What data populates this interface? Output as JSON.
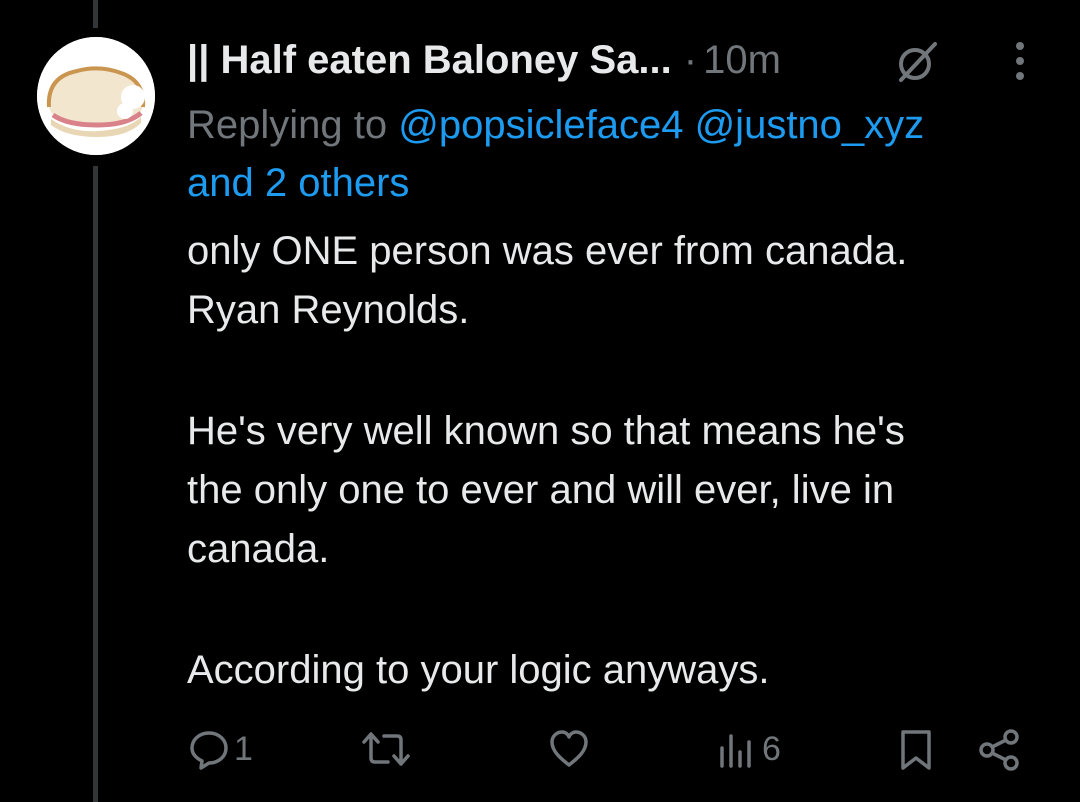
{
  "tweet": {
    "display_name": "|| Half eaten Baloney Sa...",
    "separator": "·",
    "time": "10m",
    "replying_prefix": "Replying to ",
    "mention_1": "@popsicleface4",
    "mention_2": "@justno_xyz",
    "and_others": "and 2 others",
    "text_lines": [
      "only ONE person was ever from canada.",
      "Ryan Reynolds.",
      "He's very well known so that means he's",
      "the only one to ever and will ever, live in",
      "canada.",
      "According to your logic anyways."
    ]
  },
  "actions": {
    "reply_count": "1",
    "views_count": "6"
  },
  "icons": {
    "grok": "grok-icon",
    "more": "more-options-icon",
    "reply": "reply-icon",
    "retweet": "retweet-icon",
    "like": "like-icon",
    "views": "views-icon",
    "bookmark": "bookmark-icon",
    "share": "share-icon"
  },
  "colors": {
    "background": "#000000",
    "text_primary": "#e7e9ea",
    "text_secondary": "#71767b",
    "link": "#1d9bf0",
    "thread_line": "#333639"
  }
}
